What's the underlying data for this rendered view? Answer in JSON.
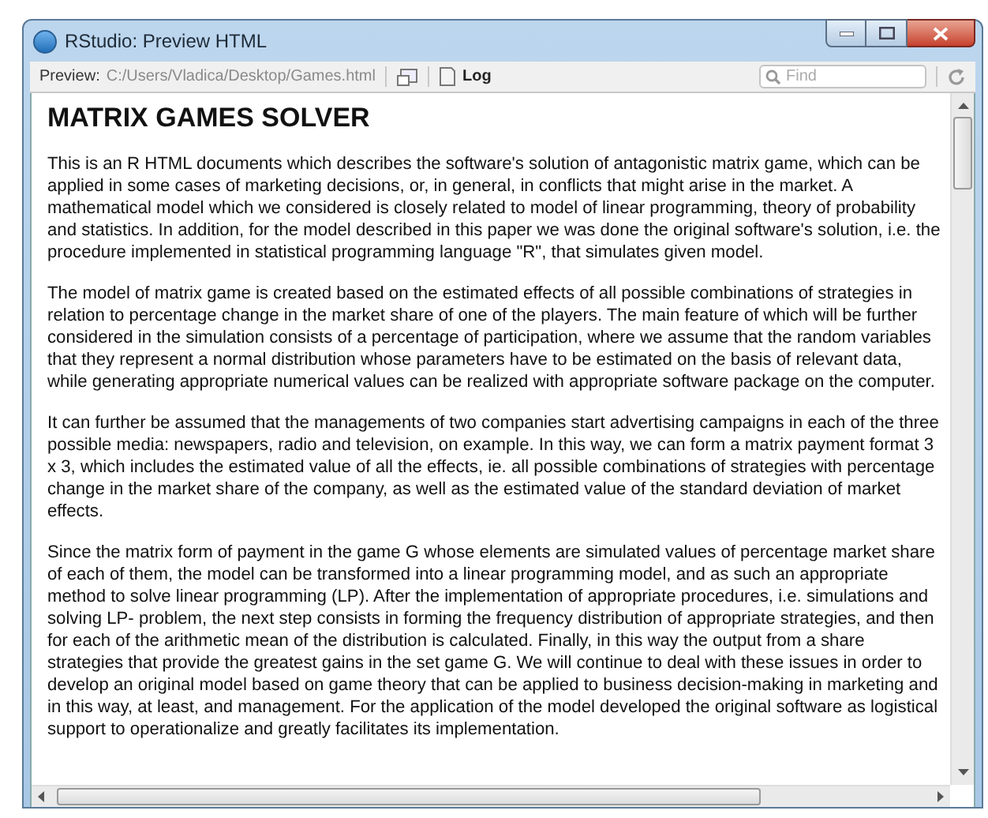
{
  "window": {
    "title": "RStudio: Preview HTML"
  },
  "toolbar": {
    "preview_label": "Preview:",
    "path": "C:/Users/Vladica/Desktop/Games.html",
    "log_label": "Log",
    "search": {
      "placeholder": "Find"
    }
  },
  "document": {
    "heading": "MATRIX GAMES SOLVER",
    "paragraphs": [
      "This is an R HTML documents which describes the software's solution of antagonistic matrix game, which can be applied in some cases of marketing decisions, or, in general, in conflicts that might arise in the market. A mathematical model which we considered is closely related to model of linear programming, theory of probability and statistics. In addition, for the model described in this paper we was done the original software's solution, i.e. the procedure implemented in statistical programming language \"R\", that simulates given model.",
      "The model of matrix game is created based on the estimated effects of all possible combinations of strategies in relation to percentage change in the market share of one of the players. The main feature of which will be further considered in the simulation consists of a percentage of participation, where we assume that the random variables that they represent a normal distribution whose parameters have to be estimated on the basis of relevant data, while generating appropriate numerical values can be realized with appropriate software package on the computer.",
      "It can further be assumed that the managements of two companies start advertising campaigns in each of the three possible media: newspapers, radio and television, on example. In this way, we can form a matrix payment format 3 x 3, which includes the estimated value of all the effects, ie. all possible combinations of strategies with percentage change in the market share of the company, as well as the estimated value of the standard deviation of market effects.",
      "Since the matrix form of payment in the game G whose elements are simulated values of percentage market share of each of them, the model can be transformed into a linear programming model, and as such an appropriate method to solve linear programming (LP). After the implementation of appropriate procedures, i.e. simulations and solving LP- problem, the next step consists in forming the frequency distribution of appropriate strategies, and then for each of the arithmetic mean of the distribution is calculated. Finally, in this way the output from a share strategies that provide the greatest gains in the set game G. We will continue to deal with these issues in order to develop an original model based on game theory that can be applied to business decision-making in marketing and in this way, at least, and management. For the application of the model developed the original software as logistical support to operationalize and greatly facilitates its implementation."
    ]
  }
}
